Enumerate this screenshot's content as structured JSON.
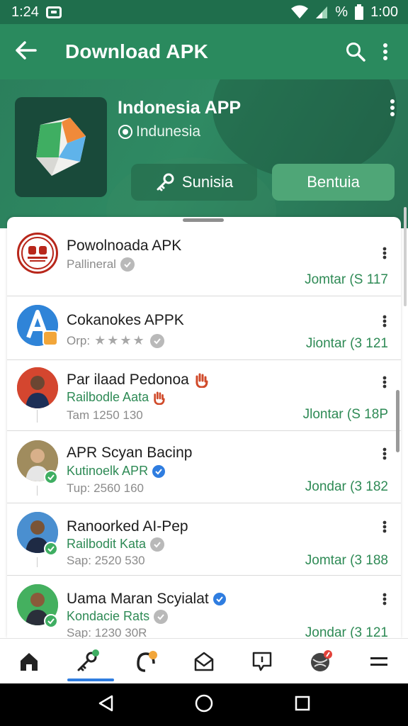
{
  "status_bar": {
    "time_left": "1:24",
    "battery_percent": "%",
    "time_right": "1:00"
  },
  "appbar": {
    "title": "Download APK"
  },
  "hero": {
    "app_name": "Indonesia APP",
    "developer": "Indunesia",
    "button_secondary": "Sunisia",
    "button_primary": "Bentuia"
  },
  "list": [
    {
      "name": "Powolnoada APK",
      "sub": "",
      "meta": "Pallineral",
      "price": "Jomtar (S 117",
      "avatar_icon": "seal-logo-icon",
      "badge": "gray"
    },
    {
      "name": "Cokanokes APPK",
      "sub": "",
      "meta": "Orp:",
      "stars": "★★★★",
      "price": "Jiontar (3 121",
      "avatar_icon": "a-logo-icon",
      "badge": "gray"
    },
    {
      "name": "Par ilaad Pedonoa",
      "sub": "Railbodle Aata",
      "meta": "Tam 1250 130",
      "price": "Jlontar (S 18P",
      "avatar_icon": "person-avatar"
    },
    {
      "name": "APR Scyan Bacinp",
      "sub": "Kutinoelk APR",
      "meta": "Tup: 2560 160",
      "price": "Jondar (3 182",
      "avatar_icon": "person-avatar"
    },
    {
      "name": "Ranoorked AI-Pep",
      "sub": "Railbodit Kata",
      "meta": "Sap: 2520 530",
      "price": "Jomtar (3 188",
      "avatar_icon": "person-avatar"
    },
    {
      "name": "Uama Maran Scyialat",
      "sub": "Kondacie Rats",
      "meta": "Sap: 1230 30R",
      "price": "Jondar (3 121",
      "avatar_icon": "person-avatar"
    }
  ],
  "bottom_nav": [
    "home-icon",
    "key-icon",
    "headset-icon",
    "mail-icon",
    "chat-icon",
    "globe-icon",
    "menu-icon"
  ],
  "colors": {
    "primary": "#2a8a5e",
    "accent_green": "#2e8a55",
    "accent_blue": "#2f7de0",
    "badge_orange": "#f2a63a",
    "badge_red": "#e3423a"
  }
}
